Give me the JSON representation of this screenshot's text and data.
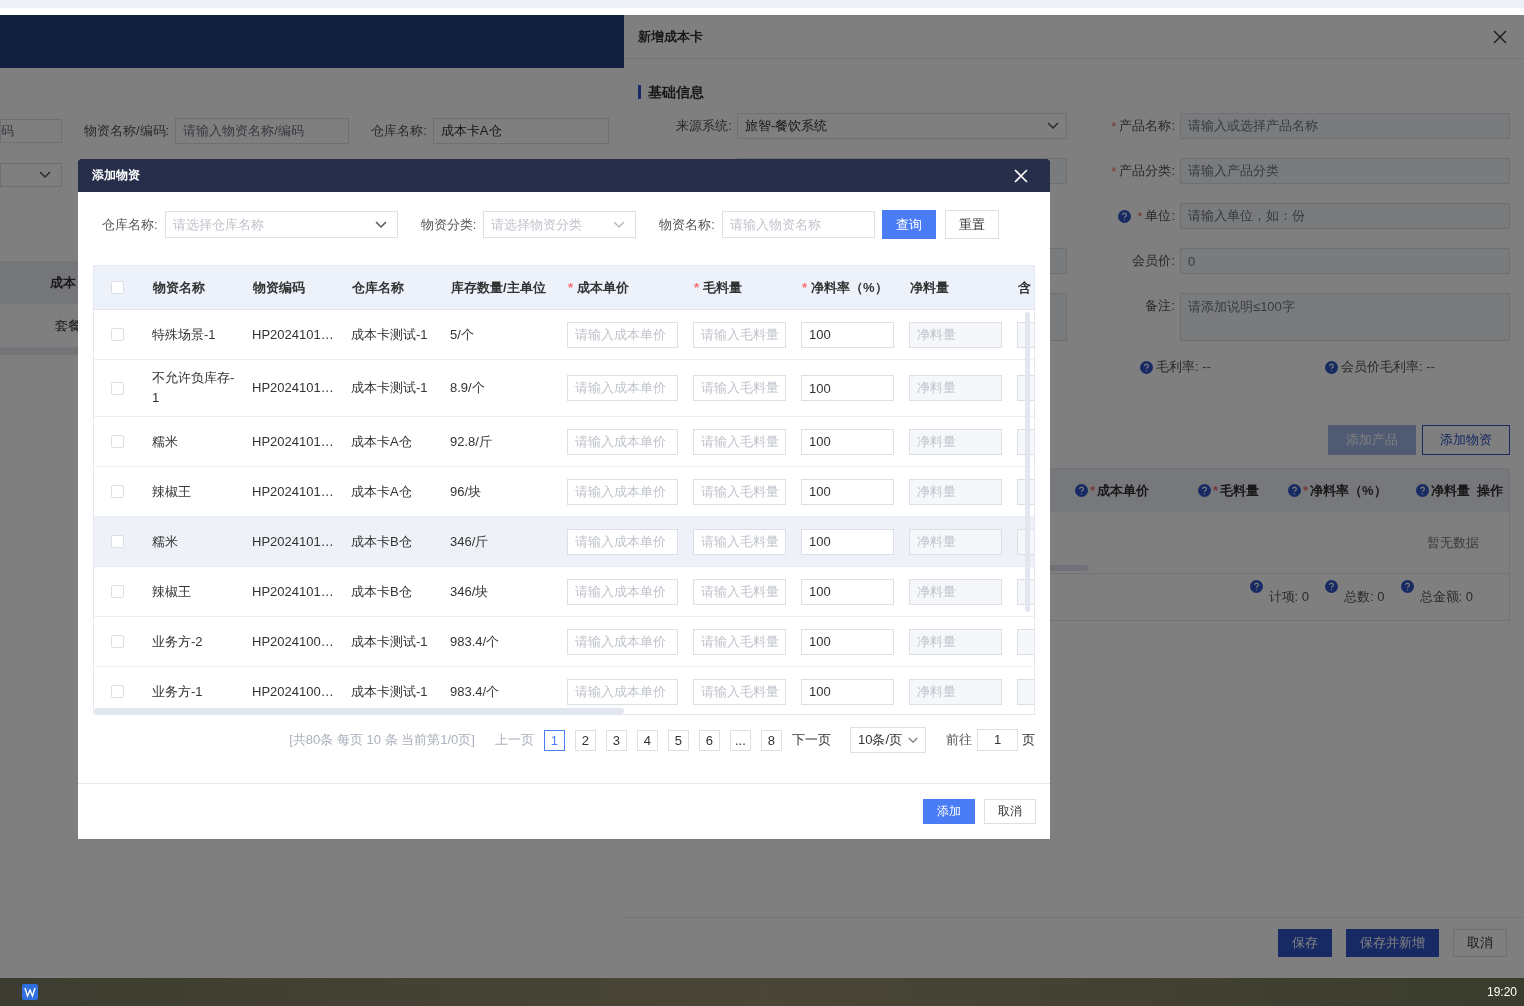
{
  "background_page": {
    "filters": [
      {
        "kind": "input",
        "placeholder": "码"
      },
      {
        "kind": "input",
        "label": "物资名称/编码:",
        "placeholder": "请输入物资名称/编码"
      },
      {
        "kind": "select",
        "label": "仓库名称:",
        "value": "成本卡A仓"
      },
      {
        "kind": "select"
      }
    ],
    "table": {
      "columns": [
        "成本"
      ],
      "rows": [
        "套餐"
      ]
    }
  },
  "drawer": {
    "title": "新增成本卡",
    "section": "基础信息",
    "rows": [
      {
        "left": {
          "kind": "select",
          "label": "来源系统:",
          "value": "旅智-餐饮系统"
        },
        "right": {
          "kind": "input",
          "label": "产品名称:",
          "mark": "*",
          "help": false,
          "placeholder": "请输入或选择产品名称"
        }
      },
      {
        "left": {
          "kind": "input"
        },
        "right": {
          "kind": "input",
          "label": "产品分类:",
          "mark": "*",
          "help": false,
          "placeholder": "请输入产品分类"
        }
      },
      {
        "right": {
          "kind": "input",
          "label": "单位:",
          "mark": "*",
          "help": true,
          "placeholder": "请输入单位，如：份"
        }
      },
      {
        "left": {
          "kind": "input"
        },
        "right": {
          "kind": "input",
          "label": "会员价:",
          "help": false,
          "placeholder": "0"
        }
      },
      {
        "left": {
          "kind": "input"
        },
        "right": {
          "kind": "textarea",
          "label": "备注:",
          "help": false,
          "placeholder": "请添加说明≤100字"
        }
      }
    ],
    "rates": [
      {
        "label": "毛利率:",
        "value": "--"
      },
      {
        "label": "会员价毛利率:",
        "value": "--"
      }
    ],
    "buttons": [
      {
        "label": "添加产品",
        "disabled": true
      },
      {
        "label": "添加物资",
        "disabled": false
      }
    ],
    "table": {
      "columns": [
        {
          "label": "成本单价",
          "mark": "*",
          "help": true
        },
        {
          "label": "毛料量",
          "mark": "*",
          "help": true
        },
        {
          "label": "净料率（%）",
          "mark": "*",
          "help": true
        },
        {
          "label": "净料量",
          "help": true
        },
        {
          "label": "操作",
          "help": false
        }
      ],
      "empty_text": "暂无数据",
      "summary": [
        {
          "label": "计项:",
          "value": "0"
        },
        {
          "label": "总数:",
          "value": "0"
        },
        {
          "label": "总金额:",
          "value": "0"
        }
      ]
    },
    "footer_buttons": [
      {
        "label": "保存",
        "kind": "primary"
      },
      {
        "label": "保存并新增",
        "kind": "primary"
      },
      {
        "label": "取消",
        "kind": "default"
      }
    ]
  },
  "modal": {
    "title": "添加物资",
    "filters": [
      {
        "kind": "select",
        "label": "仓库名称:",
        "placeholder": "请选择仓库名称"
      },
      {
        "kind": "select",
        "label": "物资分类:",
        "placeholder": "请选择物资分类"
      },
      {
        "kind": "input",
        "label": "物资名称:",
        "placeholder": "请输入物资名称"
      }
    ],
    "buttons": [
      {
        "label": "查询",
        "kind": "primary"
      },
      {
        "label": "重置",
        "kind": "default"
      }
    ],
    "table": {
      "all_checked": false,
      "columns": [
        {
          "label": "物资名称"
        },
        {
          "label": "物资编码"
        },
        {
          "label": "仓库名称"
        },
        {
          "label": "库存数量/主单位"
        },
        {
          "label": "成本单价",
          "mark": "*"
        },
        {
          "label": "毛料量",
          "mark": "*"
        },
        {
          "label": "净料率（%）",
          "mark": "*"
        },
        {
          "label": "净料量"
        },
        {
          "label": "含"
        }
      ],
      "rows": [
        {
          "checked": false,
          "hovered": false,
          "name": "特殊场景-1",
          "code": "HP2024101…",
          "warehouse": "成本卡测试-1",
          "stock": "5/个",
          "cost": "请输入成本单价",
          "gross": "请输入毛料量",
          "rate": "100",
          "net": "净料量"
        },
        {
          "checked": false,
          "hovered": false,
          "name": "不允许负库存-1",
          "code": "HP2024101…",
          "warehouse": "成本卡测试-1",
          "stock": "8.9/个",
          "cost": "请输入成本单价",
          "gross": "请输入毛料量",
          "rate": "100",
          "net": "净料量"
        },
        {
          "checked": false,
          "hovered": false,
          "name": "糯米",
          "code": "HP2024101…",
          "warehouse": "成本卡A仓",
          "stock": "92.8/斤",
          "cost": "请输入成本单价",
          "gross": "请输入毛料量",
          "rate": "100",
          "net": "净料量"
        },
        {
          "checked": false,
          "hovered": false,
          "name": "辣椒王",
          "code": "HP2024101…",
          "warehouse": "成本卡A仓",
          "stock": "96/块",
          "cost": "请输入成本单价",
          "gross": "请输入毛料量",
          "rate": "100",
          "net": "净料量"
        },
        {
          "checked": false,
          "hovered": true,
          "name": "糯米",
          "code": "HP2024101…",
          "warehouse": "成本卡B仓",
          "stock": "346/斤",
          "cost": "请输入成本单价",
          "gross": "请输入毛料量",
          "rate": "100",
          "net": "净料量"
        },
        {
          "checked": false,
          "hovered": false,
          "name": "辣椒王",
          "code": "HP2024101…",
          "warehouse": "成本卡B仓",
          "stock": "346/块",
          "cost": "请输入成本单价",
          "gross": "请输入毛料量",
          "rate": "100",
          "net": "净料量"
        },
        {
          "checked": false,
          "hovered": false,
          "name": "业务方-2",
          "code": "HP2024100…",
          "warehouse": "成本卡测试-1",
          "stock": "983.4/个",
          "cost": "请输入成本单价",
          "gross": "请输入毛料量",
          "rate": "100",
          "net": "净料量"
        },
        {
          "checked": false,
          "hovered": false,
          "name": "业务方-1",
          "code": "HP2024100…",
          "warehouse": "成本卡测试-1",
          "stock": "983.4/个",
          "cost": "请输入成本单价",
          "gross": "请输入毛料量",
          "rate": "100",
          "net": "净料量"
        }
      ]
    },
    "pagination": {
      "summary": "[共80条 每页 10 条 当前第1/0页]",
      "prev": "上一页",
      "prev_disabled": true,
      "pages": [
        {
          "label": "1",
          "selected": true
        },
        {
          "label": "2",
          "selected": false
        },
        {
          "label": "3",
          "selected": false
        },
        {
          "label": "4",
          "selected": false
        },
        {
          "label": "5",
          "selected": false
        },
        {
          "label": "6",
          "selected": false
        },
        {
          "label": "...",
          "selected": false
        },
        {
          "label": "8",
          "selected": false
        }
      ],
      "next": "下一页",
      "page_size": "10条/页",
      "goto_label": "前往",
      "goto_value": "1",
      "goto_unit": "页"
    },
    "footer_buttons": [
      {
        "label": "添加",
        "kind": "primary"
      },
      {
        "label": "取消",
        "kind": "default"
      }
    ]
  },
  "taskbar": {
    "clock": "19:20"
  }
}
